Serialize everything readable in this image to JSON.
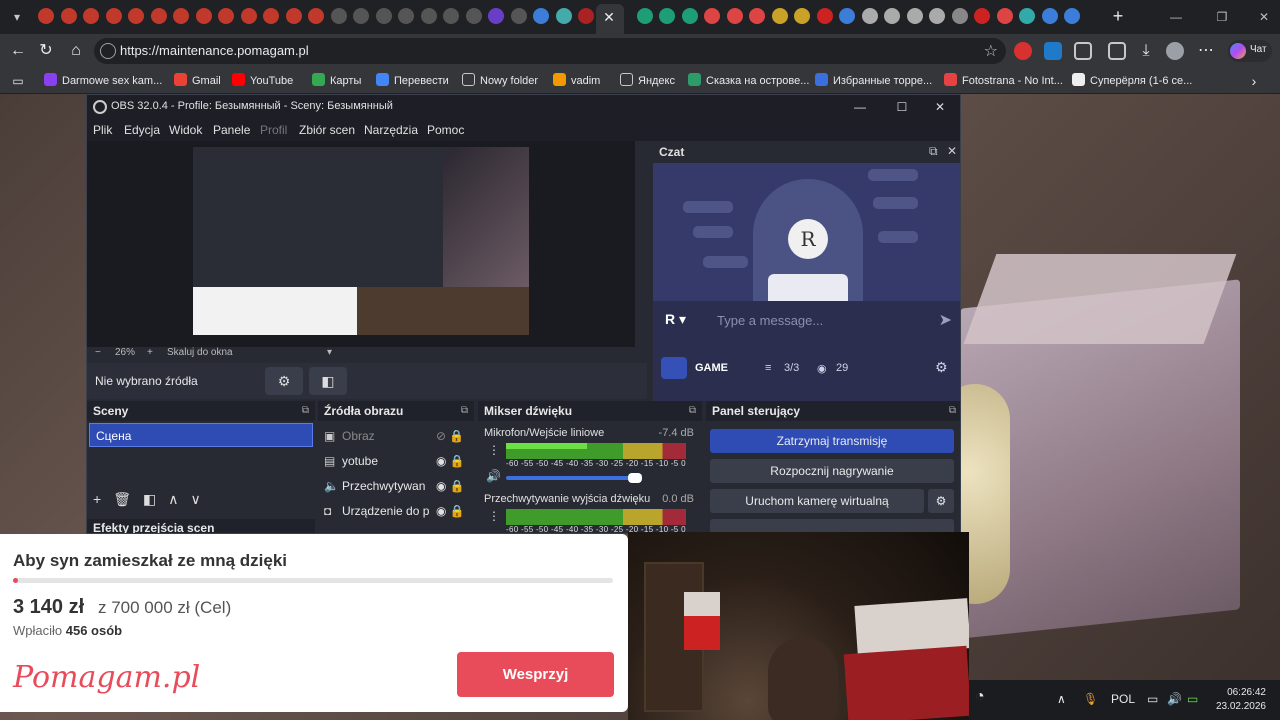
{
  "browser": {
    "url": "https://maintenance.pomagam.pl",
    "tabs_new": "+",
    "bookmarks": [
      {
        "label": "Darmowe sex kam...",
        "color": "#8a3ff0"
      },
      {
        "label": "Gmail",
        "color": "#ea4335"
      },
      {
        "label": "YouTube",
        "color": "#ff0000"
      },
      {
        "label": "Карты",
        "color": "#34a853"
      },
      {
        "label": "Перевести",
        "color": "#4285f4"
      },
      {
        "label": "Nowy folder",
        "color": "#35363a"
      },
      {
        "label": "vadim",
        "color": "#f29900"
      },
      {
        "label": "Яндекс",
        "color": "#35363a"
      },
      {
        "label": "Сказка на острове...",
        "color": "#2d9b6a"
      },
      {
        "label": "Избранные торре...",
        "color": "#3b6fe0"
      },
      {
        "label": "Fotostrana - No Int...",
        "color": "#e54343"
      },
      {
        "label": "Суперёрля (1-6 се...",
        "color": "#eeeeee"
      }
    ],
    "chat_button": "Чат"
  },
  "obs": {
    "title": "OBS 32.0.4 - Profile: Безымянный - Sceny: Безымянный",
    "menu": [
      "Plik",
      "Edycja",
      "Widok",
      "Panele",
      "Profil",
      "Zbiór scen",
      "Narzędzia",
      "Pomoc"
    ],
    "zoom": "26%",
    "zoom_mode": "Skaluj do okna",
    "no_source": "Nie wybrano źródła",
    "chat": {
      "title": "Czat",
      "placeholder": "Type a message...",
      "channel": "GAME",
      "viewers_count": "3/3",
      "watchers": "29"
    },
    "scenes": {
      "title": "Sceny",
      "items": [
        "Сцена"
      ]
    },
    "transitions_title": "Efekty przejścia scen",
    "sources": {
      "title": "Źródła obrazu",
      "items": [
        {
          "label": "Obraz",
          "icon": "image-icon"
        },
        {
          "label": "yotube",
          "icon": "window-icon"
        },
        {
          "label": "Przechwytywan",
          "icon": "speaker-icon"
        },
        {
          "label": "Urządzenie do p",
          "icon": "camera-icon"
        }
      ]
    },
    "mixer": {
      "title": "Mikser dźwięku",
      "channels": [
        {
          "name": "Mikrofon/Wejście liniowe",
          "db": "-7.4 dB",
          "level": 0.45,
          "volume": 0.7
        },
        {
          "name": "Przechwytywanie wyjścia dźwięku",
          "db": "0.0 dB",
          "level": 0.0,
          "volume": 1.0
        }
      ],
      "scale": "-60 -55 -50 -45 -40 -35 -30 -25 -20 -15 -10 -5 0"
    },
    "controls": {
      "title": "Panel sterujący",
      "stop_stream": "Zatrzymaj transmisję",
      "start_rec": "Rozpocznij nagrywanie",
      "virtual_cam": "Uruchom kamerę wirtualną"
    }
  },
  "donation": {
    "title": "Aby syn zamieszkał ze mną dzięki",
    "amount": "3 140 zł",
    "goal": "z 700 000 zł (Cel)",
    "paid_label": "Wpłaciło",
    "paid_count": "456 osób",
    "progress": 0.0045,
    "logo": "Pomagam.pl",
    "button": "Wesprzyj"
  },
  "taskbar": {
    "lang": "POL",
    "time": "06:26:42",
    "date": "23.02.2026"
  }
}
